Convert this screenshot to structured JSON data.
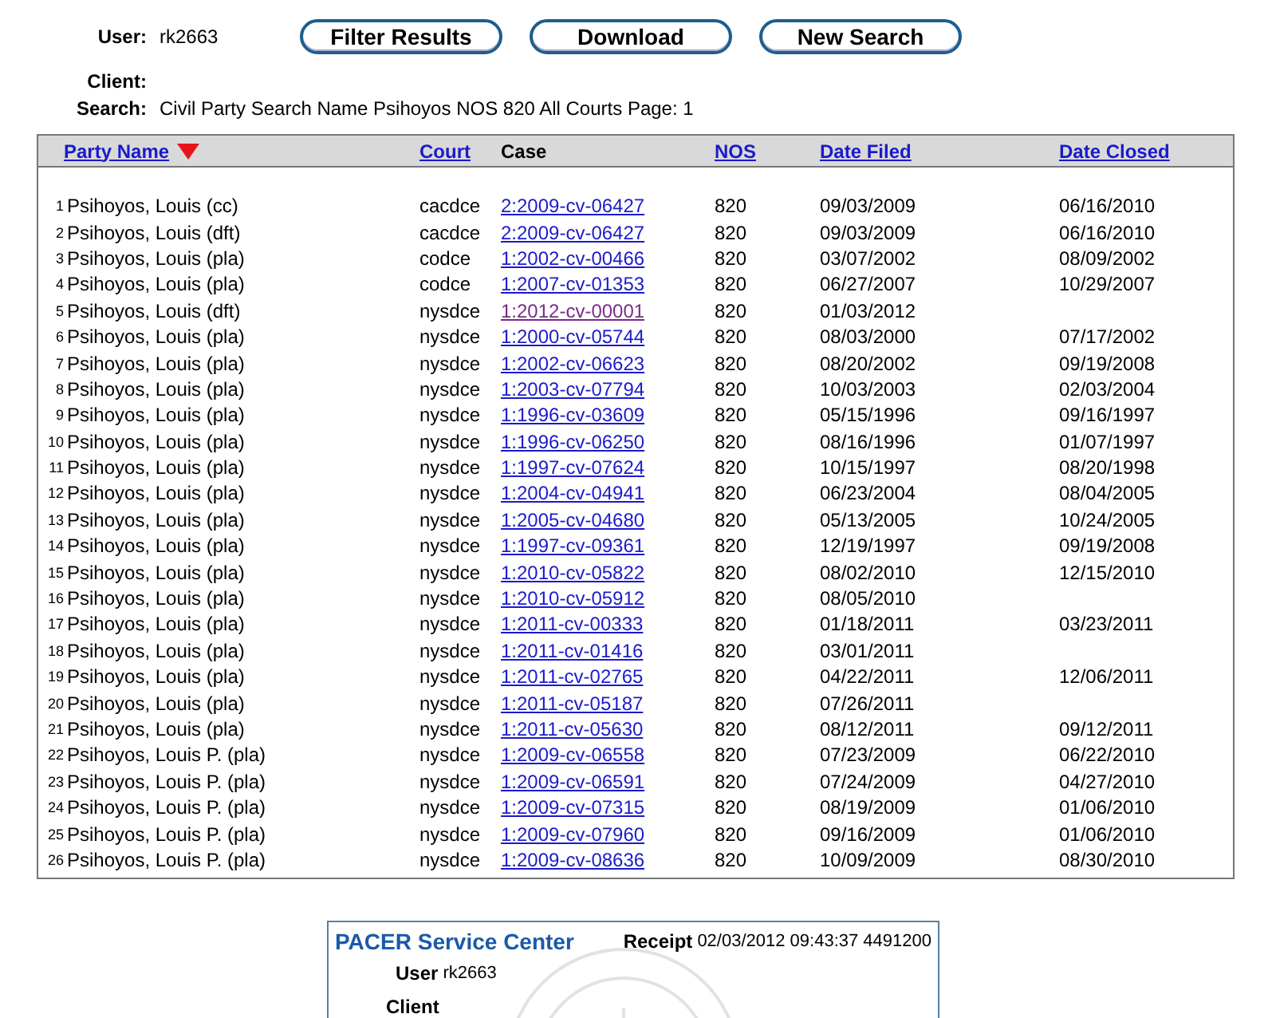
{
  "header": {
    "user_label": "User:",
    "user": "rk2663",
    "client_label": "Client:",
    "search_label": "Search:",
    "search": "Civil Party Search Name Psihoyos NOS 820 All Courts Page: 1"
  },
  "buttons": [
    "Filter Results",
    "Download",
    "New Search"
  ],
  "table": {
    "columns": [
      {
        "label": "Party Name",
        "link": true,
        "sorted": true
      },
      {
        "label": "Court",
        "link": true,
        "sorted": false
      },
      {
        "label": "Case",
        "link": false,
        "sorted": false
      },
      {
        "label": "NOS",
        "link": true,
        "sorted": false
      },
      {
        "label": "Date Filed",
        "link": true,
        "sorted": false
      },
      {
        "label": "Date Closed",
        "link": true,
        "sorted": false
      }
    ],
    "rows": [
      {
        "num": "1",
        "party": "Psihoyos, Louis (cc)",
        "court": "cacdce",
        "case": "2:2009-cv-06427",
        "visited": false,
        "nos": "820",
        "filed": "09/03/2009",
        "closed": "06/16/2010"
      },
      {
        "num": "2",
        "party": "Psihoyos, Louis (dft)",
        "court": "cacdce",
        "case": "2:2009-cv-06427",
        "visited": false,
        "nos": "820",
        "filed": "09/03/2009",
        "closed": "06/16/2010"
      },
      {
        "num": "3",
        "party": "Psihoyos, Louis (pla)",
        "court": "codce",
        "case": "1:2002-cv-00466",
        "visited": false,
        "nos": "820",
        "filed": "03/07/2002",
        "closed": "08/09/2002"
      },
      {
        "num": "4",
        "party": "Psihoyos, Louis (pla)",
        "court": "codce",
        "case": "1:2007-cv-01353",
        "visited": false,
        "nos": "820",
        "filed": "06/27/2007",
        "closed": "10/29/2007"
      },
      {
        "num": "5",
        "party": "Psihoyos, Louis (dft)",
        "court": "nysdce",
        "case": "1:2012-cv-00001",
        "visited": true,
        "nos": "820",
        "filed": "01/03/2012",
        "closed": ""
      },
      {
        "num": "6",
        "party": "Psihoyos, Louis (pla)",
        "court": "nysdce",
        "case": "1:2000-cv-05744",
        "visited": false,
        "nos": "820",
        "filed": "08/03/2000",
        "closed": "07/17/2002"
      },
      {
        "num": "7",
        "party": "Psihoyos, Louis (pla)",
        "court": "nysdce",
        "case": "1:2002-cv-06623",
        "visited": false,
        "nos": "820",
        "filed": "08/20/2002",
        "closed": "09/19/2008"
      },
      {
        "num": "8",
        "party": "Psihoyos, Louis (pla)",
        "court": "nysdce",
        "case": "1:2003-cv-07794",
        "visited": false,
        "nos": "820",
        "filed": "10/03/2003",
        "closed": "02/03/2004"
      },
      {
        "num": "9",
        "party": "Psihoyos, Louis (pla)",
        "court": "nysdce",
        "case": "1:1996-cv-03609",
        "visited": false,
        "nos": "820",
        "filed": "05/15/1996",
        "closed": "09/16/1997"
      },
      {
        "num": "10",
        "party": "Psihoyos, Louis (pla)",
        "court": "nysdce",
        "case": "1:1996-cv-06250",
        "visited": false,
        "nos": "820",
        "filed": "08/16/1996",
        "closed": "01/07/1997"
      },
      {
        "num": "11",
        "party": "Psihoyos, Louis (pla)",
        "court": "nysdce",
        "case": "1:1997-cv-07624",
        "visited": false,
        "nos": "820",
        "filed": "10/15/1997",
        "closed": "08/20/1998"
      },
      {
        "num": "12",
        "party": "Psihoyos, Louis (pla)",
        "court": "nysdce",
        "case": "1:2004-cv-04941",
        "visited": false,
        "nos": "820",
        "filed": "06/23/2004",
        "closed": "08/04/2005"
      },
      {
        "num": "13",
        "party": "Psihoyos, Louis (pla)",
        "court": "nysdce",
        "case": "1:2005-cv-04680",
        "visited": false,
        "nos": "820",
        "filed": "05/13/2005",
        "closed": "10/24/2005"
      },
      {
        "num": "14",
        "party": "Psihoyos, Louis (pla)",
        "court": "nysdce",
        "case": "1:1997-cv-09361",
        "visited": false,
        "nos": "820",
        "filed": "12/19/1997",
        "closed": "09/19/2008"
      },
      {
        "num": "15",
        "party": "Psihoyos, Louis (pla)",
        "court": "nysdce",
        "case": "1:2010-cv-05822",
        "visited": false,
        "nos": "820",
        "filed": "08/02/2010",
        "closed": "12/15/2010"
      },
      {
        "num": "16",
        "party": "Psihoyos, Louis (pla)",
        "court": "nysdce",
        "case": "1:2010-cv-05912",
        "visited": false,
        "nos": "820",
        "filed": "08/05/2010",
        "closed": ""
      },
      {
        "num": "17",
        "party": "Psihoyos, Louis (pla)",
        "court": "nysdce",
        "case": "1:2011-cv-00333",
        "visited": false,
        "nos": "820",
        "filed": "01/18/2011",
        "closed": "03/23/2011"
      },
      {
        "num": "18",
        "party": "Psihoyos, Louis (pla)",
        "court": "nysdce",
        "case": "1:2011-cv-01416",
        "visited": false,
        "nos": "820",
        "filed": "03/01/2011",
        "closed": ""
      },
      {
        "num": "19",
        "party": "Psihoyos, Louis (pla)",
        "court": "nysdce",
        "case": "1:2011-cv-02765",
        "visited": false,
        "nos": "820",
        "filed": "04/22/2011",
        "closed": "12/06/2011"
      },
      {
        "num": "20",
        "party": "Psihoyos, Louis (pla)",
        "court": "nysdce",
        "case": "1:2011-cv-05187",
        "visited": false,
        "nos": "820",
        "filed": "07/26/2011",
        "closed": ""
      },
      {
        "num": "21",
        "party": "Psihoyos, Louis (pla)",
        "court": "nysdce",
        "case": "1:2011-cv-05630",
        "visited": false,
        "nos": "820",
        "filed": "08/12/2011",
        "closed": "09/12/2011"
      },
      {
        "num": "22",
        "party": "Psihoyos, Louis P. (pla)",
        "court": "nysdce",
        "case": "1:2009-cv-06558",
        "visited": false,
        "nos": "820",
        "filed": "07/23/2009",
        "closed": "06/22/2010"
      },
      {
        "num": "23",
        "party": "Psihoyos, Louis P. (pla)",
        "court": "nysdce",
        "case": "1:2009-cv-06591",
        "visited": false,
        "nos": "820",
        "filed": "07/24/2009",
        "closed": "04/27/2010"
      },
      {
        "num": "24",
        "party": "Psihoyos, Louis P. (pla)",
        "court": "nysdce",
        "case": "1:2009-cv-07315",
        "visited": false,
        "nos": "820",
        "filed": "08/19/2009",
        "closed": "01/06/2010"
      },
      {
        "num": "25",
        "party": "Psihoyos, Louis P. (pla)",
        "court": "nysdce",
        "case": "1:2009-cv-07960",
        "visited": false,
        "nos": "820",
        "filed": "09/16/2009",
        "closed": "01/06/2010"
      },
      {
        "num": "26",
        "party": "Psihoyos, Louis P. (pla)",
        "court": "nysdce",
        "case": "1:2009-cv-08636",
        "visited": false,
        "nos": "820",
        "filed": "10/09/2009",
        "closed": "08/30/2010"
      }
    ]
  },
  "receipt": {
    "title": "PACER Service Center",
    "receipt_label": "Receipt",
    "receipt_value": "02/03/2012 09:43:37 4491200",
    "user_label": "User",
    "user": "rk2663",
    "client_label": "Client"
  }
}
